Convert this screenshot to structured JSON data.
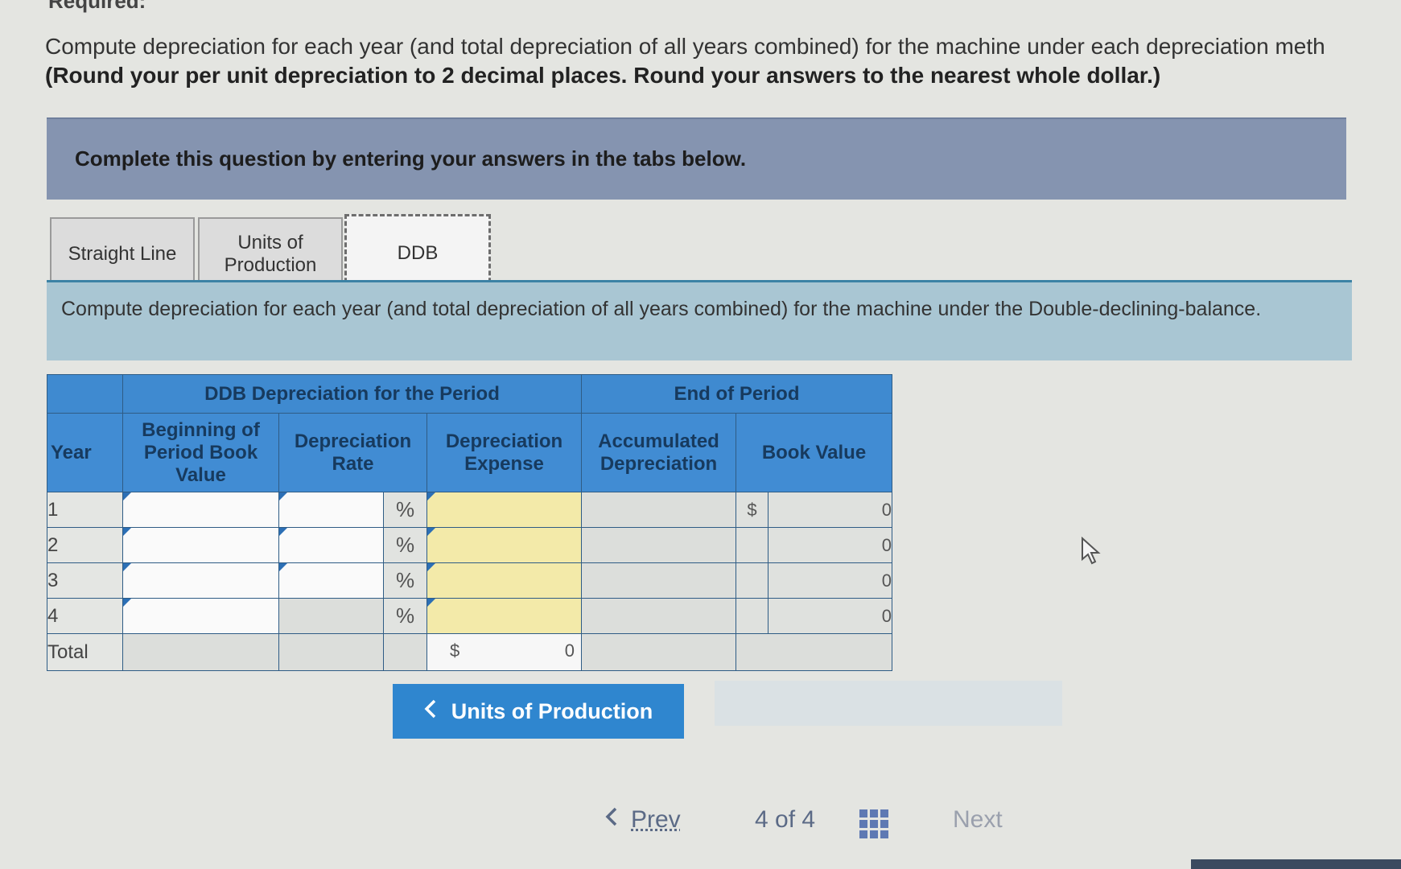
{
  "clipped_heading": "Required:",
  "instruction": {
    "line1": "Compute depreciation for each year (and total depreciation of all years combined) for the machine under each depreciation meth",
    "line2": "(Round your per unit depreciation to 2 decimal places. Round your answers to the nearest whole dollar.)"
  },
  "banner": "Complete this question by entering your answers in the tabs below.",
  "tabs": [
    {
      "label": "Straight Line"
    },
    {
      "label": "Units of Production"
    },
    {
      "label": "DDB"
    }
  ],
  "prompt": "Compute depreciation for each year (and total depreciation of all years combined) for the machine under the Double-declining-balance.",
  "table": {
    "group1": "DDB Depreciation for the Period",
    "group2": "End of Period",
    "col_year": "Year",
    "col_begin": "Beginning of Period Book Value",
    "col_rate": "Depreciation Rate",
    "col_expense": "Depreciation Expense",
    "col_accum": "Accumulated Depreciation",
    "col_book": "Book Value",
    "percent": "%",
    "currency": "$",
    "rows": [
      {
        "year": "1",
        "book": "0"
      },
      {
        "year": "2",
        "book": "0"
      },
      {
        "year": "3",
        "book": "0"
      },
      {
        "year": "4",
        "book": "0"
      }
    ],
    "total_label": "Total",
    "total_expense": "0"
  },
  "nav_button": "Units of Production",
  "pager": {
    "prev": "Prev",
    "position": "4 of 4",
    "next": "Next"
  }
}
